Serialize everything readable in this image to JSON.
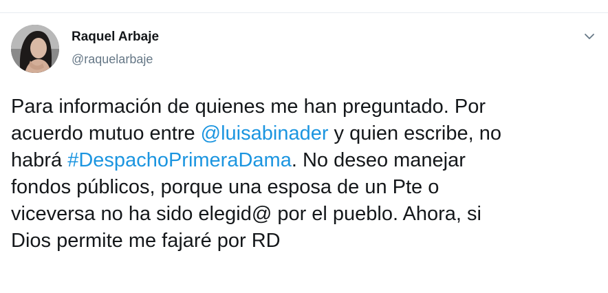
{
  "user": {
    "name": "Raquel Arbaje",
    "handle": "@raquelarbaje"
  },
  "icons": {
    "menu": "chevron-down-icon",
    "avatar": "profile-photo"
  },
  "colors": {
    "link": "#1b95e0",
    "text": "#14171a",
    "secondary": "#657786"
  },
  "tweet": {
    "lines": [
      {
        "segments": [
          {
            "text": "Para información de quienes me han preguntado. Por"
          }
        ]
      },
      {
        "segments": [
          {
            "text": "acuerdo mutuo entre "
          },
          {
            "text": "@luisabinader",
            "link": true
          },
          {
            "text": " y quien escribe, no"
          }
        ]
      },
      {
        "segments": [
          {
            "text": "habrá "
          },
          {
            "text": "#DespachoPrimeraDama",
            "link": true
          },
          {
            "text": ". No deseo manejar"
          }
        ]
      },
      {
        "segments": [
          {
            "text": "fondos públicos, porque una esposa de un Pte o"
          }
        ]
      },
      {
        "segments": [
          {
            "text": "viceversa no ha sido elegid@ por el pueblo. Ahora, si"
          }
        ]
      },
      {
        "segments": [
          {
            "text": "Dios permite me fajaré por RD"
          }
        ]
      }
    ]
  }
}
